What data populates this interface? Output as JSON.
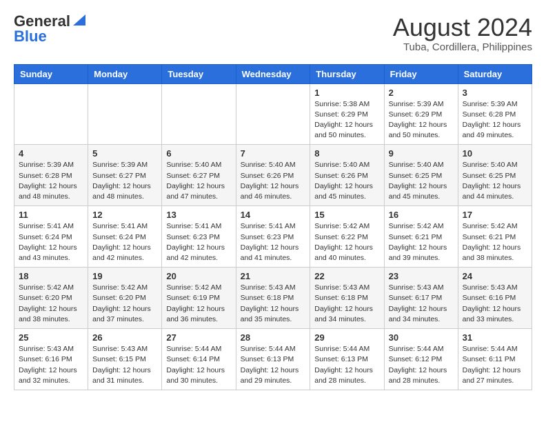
{
  "header": {
    "logo_general": "General",
    "logo_blue": "Blue",
    "month_year": "August 2024",
    "location": "Tuba, Cordillera, Philippines"
  },
  "days_of_week": [
    "Sunday",
    "Monday",
    "Tuesday",
    "Wednesday",
    "Thursday",
    "Friday",
    "Saturday"
  ],
  "weeks": [
    [
      {
        "day": "",
        "info": ""
      },
      {
        "day": "",
        "info": ""
      },
      {
        "day": "",
        "info": ""
      },
      {
        "day": "",
        "info": ""
      },
      {
        "day": "1",
        "info": "Sunrise: 5:38 AM\nSunset: 6:29 PM\nDaylight: 12 hours\nand 50 minutes."
      },
      {
        "day": "2",
        "info": "Sunrise: 5:39 AM\nSunset: 6:29 PM\nDaylight: 12 hours\nand 50 minutes."
      },
      {
        "day": "3",
        "info": "Sunrise: 5:39 AM\nSunset: 6:28 PM\nDaylight: 12 hours\nand 49 minutes."
      }
    ],
    [
      {
        "day": "4",
        "info": "Sunrise: 5:39 AM\nSunset: 6:28 PM\nDaylight: 12 hours\nand 48 minutes."
      },
      {
        "day": "5",
        "info": "Sunrise: 5:39 AM\nSunset: 6:27 PM\nDaylight: 12 hours\nand 48 minutes."
      },
      {
        "day": "6",
        "info": "Sunrise: 5:40 AM\nSunset: 6:27 PM\nDaylight: 12 hours\nand 47 minutes."
      },
      {
        "day": "7",
        "info": "Sunrise: 5:40 AM\nSunset: 6:26 PM\nDaylight: 12 hours\nand 46 minutes."
      },
      {
        "day": "8",
        "info": "Sunrise: 5:40 AM\nSunset: 6:26 PM\nDaylight: 12 hours\nand 45 minutes."
      },
      {
        "day": "9",
        "info": "Sunrise: 5:40 AM\nSunset: 6:25 PM\nDaylight: 12 hours\nand 45 minutes."
      },
      {
        "day": "10",
        "info": "Sunrise: 5:40 AM\nSunset: 6:25 PM\nDaylight: 12 hours\nand 44 minutes."
      }
    ],
    [
      {
        "day": "11",
        "info": "Sunrise: 5:41 AM\nSunset: 6:24 PM\nDaylight: 12 hours\nand 43 minutes."
      },
      {
        "day": "12",
        "info": "Sunrise: 5:41 AM\nSunset: 6:24 PM\nDaylight: 12 hours\nand 42 minutes."
      },
      {
        "day": "13",
        "info": "Sunrise: 5:41 AM\nSunset: 6:23 PM\nDaylight: 12 hours\nand 42 minutes."
      },
      {
        "day": "14",
        "info": "Sunrise: 5:41 AM\nSunset: 6:23 PM\nDaylight: 12 hours\nand 41 minutes."
      },
      {
        "day": "15",
        "info": "Sunrise: 5:42 AM\nSunset: 6:22 PM\nDaylight: 12 hours\nand 40 minutes."
      },
      {
        "day": "16",
        "info": "Sunrise: 5:42 AM\nSunset: 6:21 PM\nDaylight: 12 hours\nand 39 minutes."
      },
      {
        "day": "17",
        "info": "Sunrise: 5:42 AM\nSunset: 6:21 PM\nDaylight: 12 hours\nand 38 minutes."
      }
    ],
    [
      {
        "day": "18",
        "info": "Sunrise: 5:42 AM\nSunset: 6:20 PM\nDaylight: 12 hours\nand 38 minutes."
      },
      {
        "day": "19",
        "info": "Sunrise: 5:42 AM\nSunset: 6:20 PM\nDaylight: 12 hours\nand 37 minutes."
      },
      {
        "day": "20",
        "info": "Sunrise: 5:42 AM\nSunset: 6:19 PM\nDaylight: 12 hours\nand 36 minutes."
      },
      {
        "day": "21",
        "info": "Sunrise: 5:43 AM\nSunset: 6:18 PM\nDaylight: 12 hours\nand 35 minutes."
      },
      {
        "day": "22",
        "info": "Sunrise: 5:43 AM\nSunset: 6:18 PM\nDaylight: 12 hours\nand 34 minutes."
      },
      {
        "day": "23",
        "info": "Sunrise: 5:43 AM\nSunset: 6:17 PM\nDaylight: 12 hours\nand 34 minutes."
      },
      {
        "day": "24",
        "info": "Sunrise: 5:43 AM\nSunset: 6:16 PM\nDaylight: 12 hours\nand 33 minutes."
      }
    ],
    [
      {
        "day": "25",
        "info": "Sunrise: 5:43 AM\nSunset: 6:16 PM\nDaylight: 12 hours\nand 32 minutes."
      },
      {
        "day": "26",
        "info": "Sunrise: 5:43 AM\nSunset: 6:15 PM\nDaylight: 12 hours\nand 31 minutes."
      },
      {
        "day": "27",
        "info": "Sunrise: 5:44 AM\nSunset: 6:14 PM\nDaylight: 12 hours\nand 30 minutes."
      },
      {
        "day": "28",
        "info": "Sunrise: 5:44 AM\nSunset: 6:13 PM\nDaylight: 12 hours\nand 29 minutes."
      },
      {
        "day": "29",
        "info": "Sunrise: 5:44 AM\nSunset: 6:13 PM\nDaylight: 12 hours\nand 28 minutes."
      },
      {
        "day": "30",
        "info": "Sunrise: 5:44 AM\nSunset: 6:12 PM\nDaylight: 12 hours\nand 28 minutes."
      },
      {
        "day": "31",
        "info": "Sunrise: 5:44 AM\nSunset: 6:11 PM\nDaylight: 12 hours\nand 27 minutes."
      }
    ]
  ]
}
